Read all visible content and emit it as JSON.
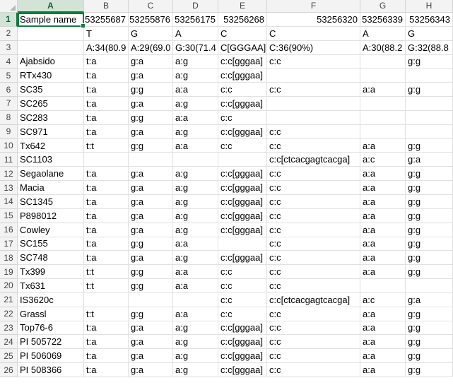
{
  "columns": [
    "A",
    "B",
    "C",
    "D",
    "E",
    "F",
    "G",
    "H"
  ],
  "selected_column": "A",
  "selected_row": 1,
  "active_cell": "A1",
  "rows": [
    {
      "n": "1",
      "cells": [
        "Sample name",
        "53255687",
        "53255876",
        "53256175",
        "53256268",
        "53256320",
        "53256339",
        "53256343"
      ]
    },
    {
      "n": "2",
      "cells": [
        "",
        "T",
        "G",
        "A",
        "C",
        "C",
        "A",
        "G"
      ]
    },
    {
      "n": "3",
      "cells": [
        "",
        "A:34(80.9",
        "A:29(69.0",
        "G:30(71.4",
        "C[GGGAA]:",
        "C:36(90%)",
        "A:30(88.2",
        "G:32(88.8"
      ]
    },
    {
      "n": "4",
      "cells": [
        "Ajabsido",
        "t:a",
        "g:a",
        "a:g",
        "c:c[gggaa]",
        "c:c",
        "",
        "g:g"
      ]
    },
    {
      "n": "5",
      "cells": [
        "RTx430",
        "t:a",
        "g:a",
        "a:g",
        "c:c[gggaa]",
        "",
        "",
        ""
      ]
    },
    {
      "n": "6",
      "cells": [
        "SC35",
        "t:a",
        "g:g",
        "a:a",
        "c:c",
        "c:c",
        "a:a",
        "g:g"
      ]
    },
    {
      "n": "7",
      "cells": [
        "SC265",
        "t:a",
        "g:a",
        "a:g",
        "c:c[gggaa]",
        "",
        "",
        ""
      ]
    },
    {
      "n": "8",
      "cells": [
        "SC283",
        "t:a",
        "g:g",
        "a:a",
        "c:c",
        "",
        "",
        ""
      ]
    },
    {
      "n": "9",
      "cells": [
        "SC971",
        "t:a",
        "g:a",
        "a:g",
        "c:c[gggaa]",
        "c:c",
        "",
        ""
      ]
    },
    {
      "n": "10",
      "cells": [
        "Tx642",
        "t:t",
        "g:g",
        "a:a",
        "c:c",
        "c:c",
        "a:a",
        "g:g"
      ]
    },
    {
      "n": "11",
      "cells": [
        "SC1103",
        "",
        "",
        "",
        "",
        "c:c[ctcacgagtcacga]",
        "a:c",
        "g:a"
      ]
    },
    {
      "n": "12",
      "cells": [
        "Segaolane",
        "t:a",
        "g:a",
        "a:g",
        "c:c[gggaa]",
        "c:c",
        "a:a",
        "g:g"
      ]
    },
    {
      "n": "13",
      "cells": [
        "Macia",
        "t:a",
        "g:a",
        "a:g",
        "c:c[gggaa]",
        "c:c",
        "a:a",
        "g:g"
      ]
    },
    {
      "n": "14",
      "cells": [
        "SC1345",
        "t:a",
        "g:a",
        "a:g",
        "c:c[gggaa]",
        "c:c",
        "a:a",
        "g:g"
      ]
    },
    {
      "n": "15",
      "cells": [
        "P898012",
        "t:a",
        "g:a",
        "a:g",
        "c:c[gggaa]",
        "c:c",
        "a:a",
        "g:g"
      ]
    },
    {
      "n": "16",
      "cells": [
        "Cowley",
        "t:a",
        "g:a",
        "a:g",
        "c:c[gggaa]",
        "c:c",
        "a:a",
        "g:g"
      ]
    },
    {
      "n": "17",
      "cells": [
        "SC155",
        "t:a",
        "g:g",
        "a:a",
        "",
        "c:c",
        "a:a",
        "g:g"
      ]
    },
    {
      "n": "18",
      "cells": [
        "SC748",
        "t:a",
        "g:a",
        "a:g",
        "c:c[gggaa]",
        "c:c",
        "a:a",
        "g:g"
      ]
    },
    {
      "n": "19",
      "cells": [
        "Tx399",
        "t:t",
        "g:g",
        "a:a",
        "c:c",
        "c:c",
        "a:a",
        "g:g"
      ]
    },
    {
      "n": "20",
      "cells": [
        "Tx631",
        "t:t",
        "g:g",
        "a:a",
        "c:c",
        "c:c",
        "",
        ""
      ]
    },
    {
      "n": "21",
      "cells": [
        "IS3620c",
        "",
        "",
        "",
        "c:c",
        "c:c[ctcacgagtcacga]",
        "a:c",
        "g:a"
      ]
    },
    {
      "n": "22",
      "cells": [
        "Grassl",
        "t:t",
        "g:g",
        "a:a",
        "c:c",
        "c:c",
        "a:a",
        "g:g"
      ]
    },
    {
      "n": "23",
      "cells": [
        "Top76-6",
        "t:a",
        "g:a",
        "a:g",
        "c:c[gggaa]",
        "c:c",
        "a:a",
        "g:g"
      ]
    },
    {
      "n": "24",
      "cells": [
        "PI 505722",
        "t:a",
        "g:a",
        "a:g",
        "c:c[gggaa]",
        "c:c",
        "a:a",
        "g:g"
      ]
    },
    {
      "n": "25",
      "cells": [
        "PI 506069",
        "t:a",
        "g:a",
        "a:g",
        "c:c[gggaa]",
        "c:c",
        "a:a",
        "g:g"
      ]
    },
    {
      "n": "26",
      "cells": [
        "PI 508366",
        "t:a",
        "g:a",
        "a:g",
        "c:c[gggaa]",
        "c:c",
        "a:a",
        "g:g"
      ]
    }
  ]
}
